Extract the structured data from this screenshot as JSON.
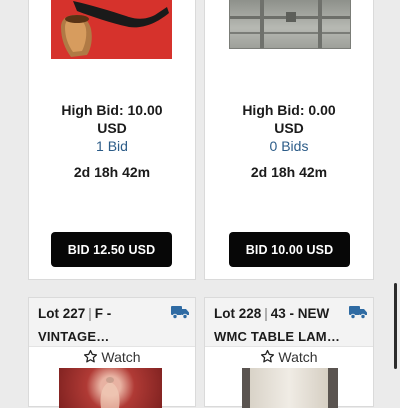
{
  "cards": [
    {
      "high_bid": "High Bid: 10.00",
      "currency": "USD",
      "bids": "1 Bid",
      "time_left": "2d 18h 42m",
      "bid_button": "BID 12.50 USD"
    },
    {
      "high_bid": "High Bid: 0.00",
      "currency": "USD",
      "bids": "0 Bids",
      "time_left": "2d 18h 42m",
      "bid_button": "BID 10.00 USD"
    },
    {
      "lot": "Lot 227",
      "title_start": "F -",
      "title_more": "VINTAGE…",
      "watch": "Watch",
      "shipping_icon": "truck-icon"
    },
    {
      "lot": "Lot 228",
      "title_start": "43 - NEW",
      "title_more": "WMC TABLE LAM…",
      "watch": "Watch",
      "shipping_icon": "truck-icon"
    }
  ],
  "colors": {
    "link": "#2c5c88",
    "button_bg": "#070707",
    "truck": "#2f6ba3"
  }
}
